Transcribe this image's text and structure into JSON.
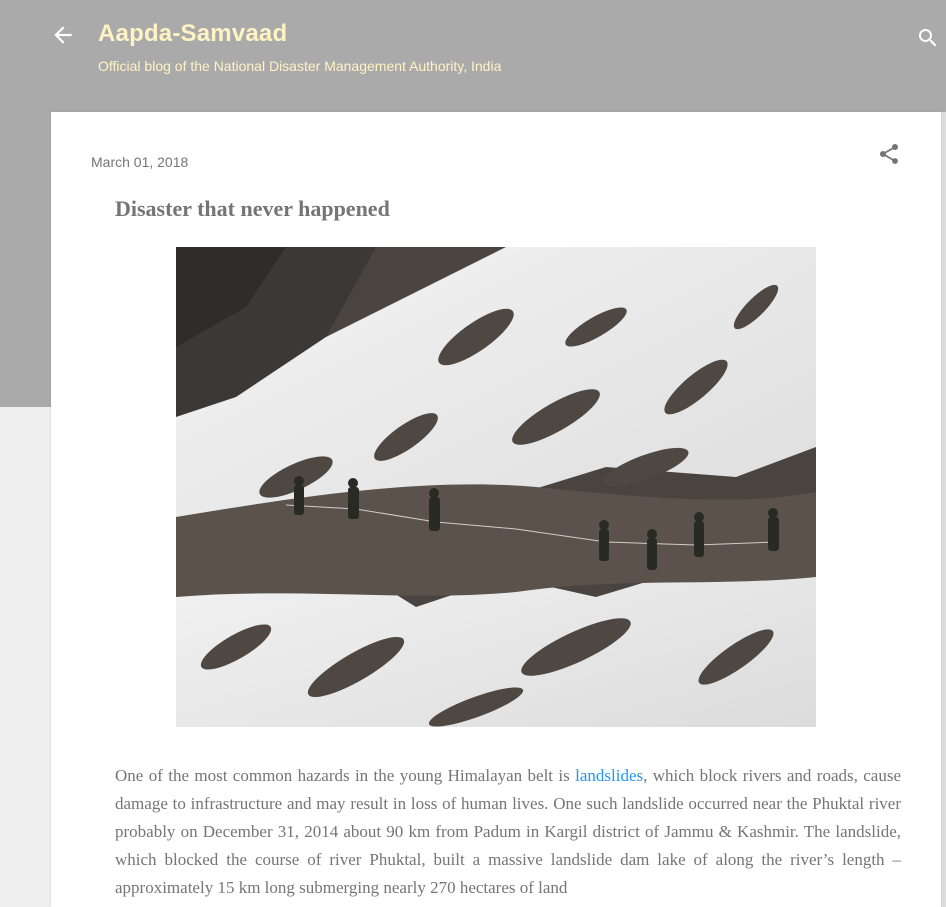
{
  "header": {
    "back_icon": "arrow-left-icon",
    "title": "Aapda-Samvaad",
    "subtitle": "Official blog of the National Disaster Management Authority, India",
    "search_icon": "search-icon"
  },
  "post": {
    "date": "March 01, 2018",
    "share_icon": "share-icon",
    "title": "Disaster that never happened",
    "image": {
      "content": "soldiers-roped-traverse-snowy-mountain-slope"
    },
    "body": {
      "text_before_link": "One of the most common hazards in the young Himalayan belt is ",
      "link_text": "landslides",
      "text_after_link": ", which block rivers and roads, cause damage to infrastructure and may result in loss of human lives. One such landslide occurred near the Phuktal river probably on December 31, 2014 about 90 km from Padum in Kargil district of Jammu & Kashmir. The landslide, which blocked the course of river Phuktal, built a massive landslide dam lake of along the river’s length – approximately 15 km long submerging nearly 270 hectares of land"
    }
  },
  "colors": {
    "header_bg": "#aaaaaa",
    "page_bg": "#eeeeee",
    "title_color": "#fff3c4",
    "text_gray": "#757575",
    "link_blue": "#2196f3"
  }
}
